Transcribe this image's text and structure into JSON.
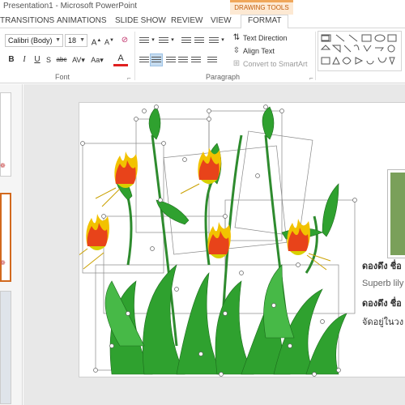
{
  "titlebar": {
    "title": "Presentation1 - Microsoft PowerPoint",
    "context_group": "DRAWING TOOLS"
  },
  "tabs": [
    {
      "label": "TRANSITIONS"
    },
    {
      "label": "ANIMATIONS"
    },
    {
      "label": "SLIDE SHOW"
    },
    {
      "label": "REVIEW"
    },
    {
      "label": "VIEW"
    },
    {
      "label": "FORMAT"
    }
  ],
  "ribbon": {
    "font": {
      "family": "Calibri (Body)",
      "size": "18",
      "label": "Font"
    },
    "paragraph": {
      "label": "Paragraph",
      "text_direction": "Text Direction",
      "align_text": "Align Text",
      "convert_smartart": "Convert to SmartArt"
    }
  },
  "slide": {
    "text_lines": [
      "ดองดึง ชื่อ",
      "Superb lily",
      "ดองดึง ชื่อ",
      "จัดอยู่ในวง"
    ]
  },
  "colors": {
    "accent": "#c43e1c",
    "context": "#f0a75a",
    "selected": "#c5dcf0"
  }
}
